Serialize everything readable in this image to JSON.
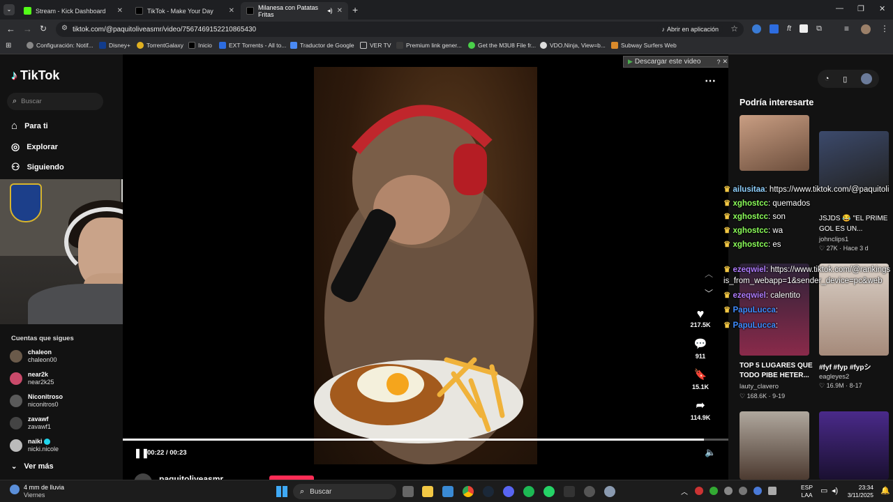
{
  "tabs": [
    {
      "label": "Stream - Kick Dashboard",
      "color": "#53fc18"
    },
    {
      "label": "TikTok - Make Your Day",
      "color": "#ffffff"
    },
    {
      "label": "Milanesa con Patatas Fritas",
      "color": "#ffffff"
    }
  ],
  "address": {
    "url": "tiktok.com/@paquitoliveasmr/video/7567469152210865430",
    "open_app": "Abrir en aplicación"
  },
  "bookmarks": [
    "Configuración: Notif...",
    "Disney+",
    "TorrentGalaxy",
    "Inicio",
    "EXT Torrents - All to...",
    "Traductor de Google",
    "VER TV",
    "Premium link gener...",
    "Get the M3U8 File fr...",
    "VDO.Ninja, View=b...",
    "Subway Surfers Web"
  ],
  "sidebar": {
    "logo": "TikTok",
    "search_placeholder": "Buscar",
    "nav": [
      "Para ti",
      "Explorar",
      "Siguiendo"
    ],
    "following_title": "Cuentas que sigues",
    "accounts": [
      {
        "name": "chaleon",
        "handle": "chaleon00"
      },
      {
        "name": "near2k",
        "handle": "near2k25"
      },
      {
        "name": "Niconitroso",
        "handle": "niconitros0"
      },
      {
        "name": "zavawf",
        "handle": "zavawf1"
      },
      {
        "name": "naiki",
        "handle": "nicki.nicole"
      }
    ],
    "more": "Ver más"
  },
  "download_banner": "Descargar este video",
  "video": {
    "time": "00:22 / 00:23",
    "progress": 0.96,
    "author": "paquitoliveasmr",
    "likes": "217.5K",
    "comments": "911",
    "saves": "15.1K",
    "shares": "114.9K"
  },
  "suggested": {
    "title": "Podría interesarte",
    "items": [
      {
        "caption": "TOP 5 LUGARES QUE TODO PIBE HETER...",
        "author": "lauty_clavero",
        "likes": "168.6K",
        "date": "9-19"
      },
      {
        "caption": "#fyf #fyp #fypシ",
        "author": "eagleyes2",
        "likes": "16.9M",
        "date": "8-17"
      },
      {
        "caption": "JSJDS 😂 \"EL PRIME GOL ES UN...",
        "author": "johnclips1",
        "likes": "27K",
        "date": "Hace 3 d"
      }
    ]
  },
  "chat": [
    {
      "user": "ailusitaa",
      "msg": ": https://www.tiktok.com/@paquitoli",
      "color": "#8fd0ff"
    },
    {
      "user": "xghostcc",
      "msg": ": quemados",
      "color": "#8cff5a"
    },
    {
      "user": "xghostcc",
      "msg": ": son",
      "color": "#8cff5a"
    },
    {
      "user": "xghostcc",
      "msg": ": wa",
      "color": "#8cff5a"
    },
    {
      "user": "xghostcc",
      "msg": ": es",
      "color": "#8cff5a"
    },
    {
      "user": "ezeqwiel",
      "msg": ": https://www.tiktok.com/@rankings",
      "color": "#b07cff"
    },
    {
      "user": "",
      "msg": "is_from_webapp=1&sender_device=pc&web",
      "color": "#ffffff"
    },
    {
      "user": "ezeqwiel",
      "msg": ": calentito",
      "color": "#b07cff"
    },
    {
      "user": "PapuLucca",
      "msg": ":",
      "color": "#3f8cff"
    },
    {
      "user": "PapuLucca",
      "msg": ":",
      "color": "#3f8cff"
    }
  ],
  "taskbar": {
    "weather": "4 mm de lluvia",
    "weather_sub": "Viernes",
    "search": "Buscar",
    "lang1": "ESP",
    "lang2": "LAA",
    "time": "23:34",
    "date": "3/11/2025"
  }
}
